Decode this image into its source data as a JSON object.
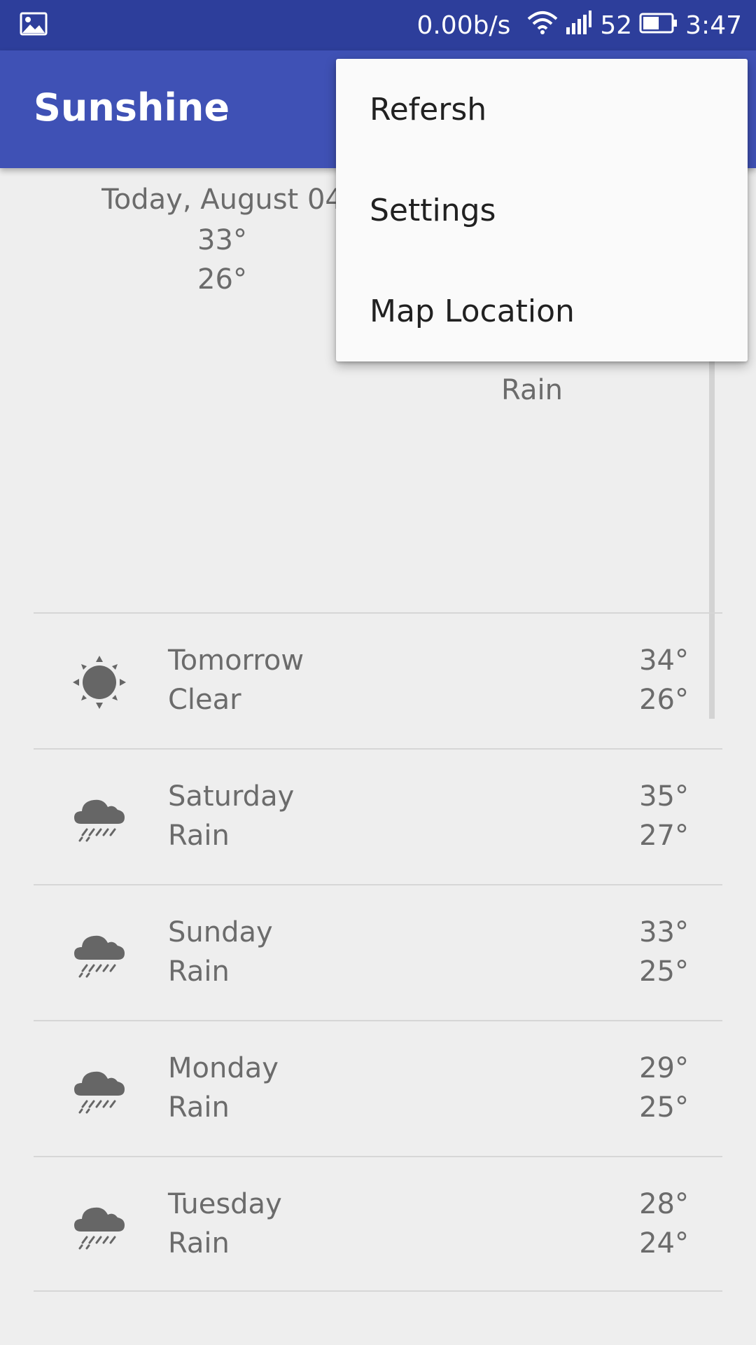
{
  "status_bar": {
    "speed": "0.00b/s",
    "battery": "52",
    "time": "3:47"
  },
  "app_bar": {
    "title": "Sunshine"
  },
  "menu": {
    "items": [
      {
        "label": "Refersh"
      },
      {
        "label": "Settings"
      },
      {
        "label": "Map Location"
      }
    ]
  },
  "today": {
    "date": "Today, August 04",
    "high": "33°",
    "low": "26°",
    "condition": "Rain",
    "icon": "rain-art-icon"
  },
  "forecast": [
    {
      "day": "Tomorrow",
      "condition": "Clear",
      "high": "34°",
      "low": "26°",
      "icon": "sun-icon"
    },
    {
      "day": "Saturday",
      "condition": "Rain",
      "high": "35°",
      "low": "27°",
      "icon": "rain-cloud-icon"
    },
    {
      "day": "Sunday",
      "condition": "Rain",
      "high": "33°",
      "low": "25°",
      "icon": "rain-cloud-icon"
    },
    {
      "day": "Monday",
      "condition": "Rain",
      "high": "29°",
      "low": "25°",
      "icon": "rain-cloud-icon"
    },
    {
      "day": "Tuesday",
      "condition": "Rain",
      "high": "28°",
      "low": "24°",
      "icon": "rain-cloud-icon"
    }
  ],
  "colors": {
    "status_bar": "#2d3e9b",
    "app_bar": "#3f51b5",
    "background": "#eeeeee",
    "text_secondary": "#6b6b6b",
    "rain_blue": "#2e86c1"
  }
}
